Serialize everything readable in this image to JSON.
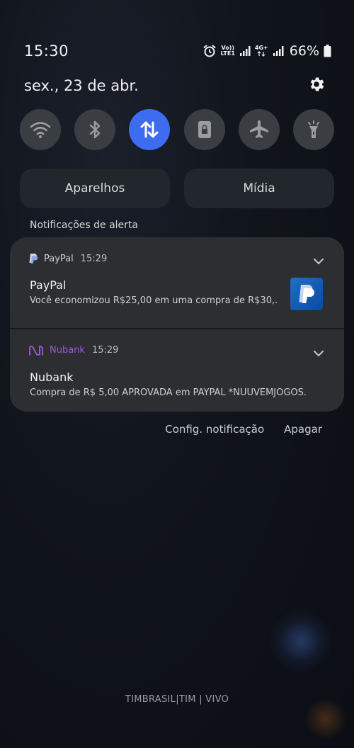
{
  "status_bar": {
    "time": "15:30",
    "volte_label_top": "Vo))",
    "volte_label_bottom": "LTE1",
    "network_label_top": "4G+",
    "battery_percent": "66%"
  },
  "header": {
    "date": "sex., 23 de abr."
  },
  "quick_toggles": [
    {
      "name": "wifi",
      "icon": "wifi-icon",
      "active": false
    },
    {
      "name": "bluetooth",
      "icon": "bluetooth-icon",
      "active": false
    },
    {
      "name": "mobile-data",
      "icon": "data-transfer-icon",
      "active": true
    },
    {
      "name": "rotation-lock",
      "icon": "lock-screen-icon",
      "active": false
    },
    {
      "name": "airplane-mode",
      "icon": "airplane-icon",
      "active": false
    },
    {
      "name": "flashlight",
      "icon": "flashlight-icon",
      "active": false
    }
  ],
  "panel_buttons": {
    "devices_label": "Aparelhos",
    "media_label": "Mídia"
  },
  "section": {
    "title": "Notificações de alerta"
  },
  "notifications": [
    {
      "app": "PayPal",
      "time": "15:29",
      "title": "PayPal",
      "body": "Você economizou R$25,00 em uma compra de R$30,..",
      "icon": "paypal-icon"
    },
    {
      "app": "Nubank",
      "time": "15:29",
      "title": "Nubank",
      "body": "Compra de R$ 5,00 APROVADA em PAYPAL *NUUVEMJOGOS.",
      "icon": "nubank-icon"
    }
  ],
  "actions": {
    "settings_label": "Config. notificação",
    "clear_label": "Apagar"
  },
  "footer": {
    "carrier": "TIMBRASIL|TIM | VIVO"
  },
  "colors": {
    "accent": "#3d6cf0",
    "card_bg": "#2c2e32",
    "nubank_purple": "#a05ad6"
  }
}
